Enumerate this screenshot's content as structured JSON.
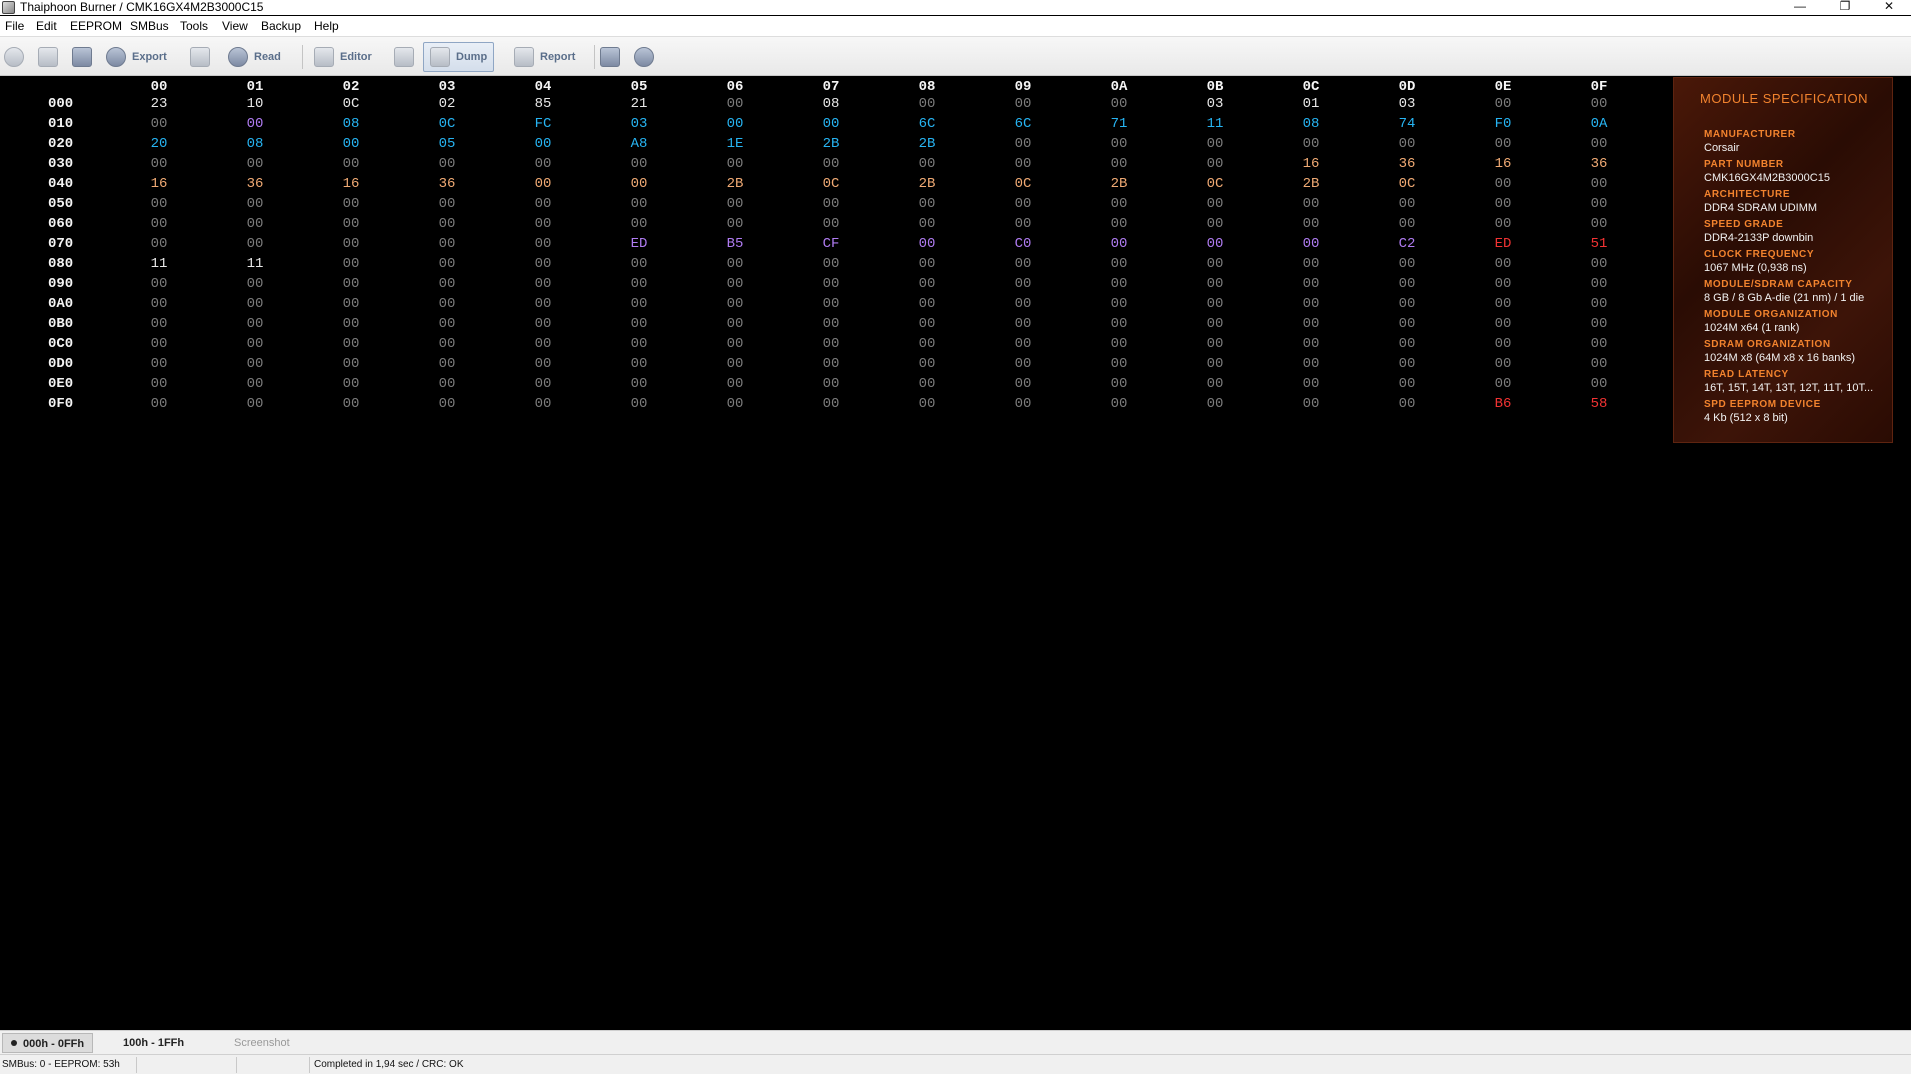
{
  "window": {
    "title": "Thaiphoon Burner / CMK16GX4M2B3000C15",
    "controls": {
      "minimize": "—",
      "maximize": "❐",
      "close": "✕"
    }
  },
  "menu": [
    "File",
    "Edit",
    "EEPROM",
    "SMBus",
    "Tools",
    "View",
    "Backup",
    "Help"
  ],
  "toolbar": {
    "export": "Export",
    "read": "Read",
    "editor": "Editor",
    "dump": "Dump",
    "report": "Report"
  },
  "dump": {
    "column_headers": [
      "00",
      "01",
      "02",
      "03",
      "04",
      "05",
      "06",
      "07",
      "08",
      "09",
      "0A",
      "0B",
      "0C",
      "0D",
      "0E",
      "0F"
    ],
    "colors": {
      "w": "#e8e8e8",
      "g": "#7c7c7c",
      "c": "#27b4f2",
      "p": "#b07cf2",
      "o": "#f0aa74",
      "r": "#f23333"
    },
    "rows": [
      {
        "addr": "000",
        "bytes": [
          "23",
          "10",
          "0C",
          "02",
          "85",
          "21",
          "00",
          "08",
          "00",
          "00",
          "00",
          "03",
          "01",
          "03",
          "00",
          "00"
        ],
        "colors": [
          "w",
          "w",
          "w",
          "w",
          "w",
          "w",
          "g",
          "w",
          "g",
          "g",
          "g",
          "w",
          "w",
          "w",
          "g",
          "g"
        ]
      },
      {
        "addr": "010",
        "bytes": [
          "00",
          "00",
          "08",
          "0C",
          "FC",
          "03",
          "00",
          "00",
          "6C",
          "6C",
          "71",
          "11",
          "08",
          "74",
          "F0",
          "0A"
        ],
        "colors": [
          "g",
          "p",
          "c",
          "c",
          "c",
          "c",
          "c",
          "c",
          "c",
          "c",
          "c",
          "c",
          "c",
          "c",
          "c",
          "c"
        ]
      },
      {
        "addr": "020",
        "bytes": [
          "20",
          "08",
          "00",
          "05",
          "00",
          "A8",
          "1E",
          "2B",
          "2B",
          "00",
          "00",
          "00",
          "00",
          "00",
          "00",
          "00"
        ],
        "colors": [
          "c",
          "c",
          "c",
          "c",
          "c",
          "c",
          "c",
          "c",
          "c",
          "g",
          "g",
          "g",
          "g",
          "g",
          "g",
          "g"
        ]
      },
      {
        "addr": "030",
        "bytes": [
          "00",
          "00",
          "00",
          "00",
          "00",
          "00",
          "00",
          "00",
          "00",
          "00",
          "00",
          "00",
          "16",
          "36",
          "16",
          "36"
        ],
        "colors": [
          "g",
          "g",
          "g",
          "g",
          "g",
          "g",
          "g",
          "g",
          "g",
          "g",
          "g",
          "g",
          "o",
          "o",
          "o",
          "o"
        ]
      },
      {
        "addr": "040",
        "bytes": [
          "16",
          "36",
          "16",
          "36",
          "00",
          "00",
          "2B",
          "0C",
          "2B",
          "0C",
          "2B",
          "0C",
          "2B",
          "0C",
          "00",
          "00"
        ],
        "colors": [
          "o",
          "o",
          "o",
          "o",
          "o",
          "o",
          "o",
          "o",
          "o",
          "o",
          "o",
          "o",
          "o",
          "o",
          "g",
          "g"
        ]
      },
      {
        "addr": "050",
        "bytes": [
          "00",
          "00",
          "00",
          "00",
          "00",
          "00",
          "00",
          "00",
          "00",
          "00",
          "00",
          "00",
          "00",
          "00",
          "00",
          "00"
        ],
        "colors": [
          "g",
          "g",
          "g",
          "g",
          "g",
          "g",
          "g",
          "g",
          "g",
          "g",
          "g",
          "g",
          "g",
          "g",
          "g",
          "g"
        ]
      },
      {
        "addr": "060",
        "bytes": [
          "00",
          "00",
          "00",
          "00",
          "00",
          "00",
          "00",
          "00",
          "00",
          "00",
          "00",
          "00",
          "00",
          "00",
          "00",
          "00"
        ],
        "colors": [
          "g",
          "g",
          "g",
          "g",
          "g",
          "g",
          "g",
          "g",
          "g",
          "g",
          "g",
          "g",
          "g",
          "g",
          "g",
          "g"
        ]
      },
      {
        "addr": "070",
        "bytes": [
          "00",
          "00",
          "00",
          "00",
          "00",
          "ED",
          "B5",
          "CF",
          "00",
          "C0",
          "00",
          "00",
          "00",
          "C2",
          "ED",
          "51"
        ],
        "colors": [
          "g",
          "g",
          "g",
          "g",
          "g",
          "p",
          "p",
          "p",
          "p",
          "p",
          "p",
          "p",
          "p",
          "p",
          "r",
          "r"
        ]
      },
      {
        "addr": "080",
        "bytes": [
          "11",
          "11",
          "00",
          "00",
          "00",
          "00",
          "00",
          "00",
          "00",
          "00",
          "00",
          "00",
          "00",
          "00",
          "00",
          "00"
        ],
        "colors": [
          "w",
          "w",
          "g",
          "g",
          "g",
          "g",
          "g",
          "g",
          "g",
          "g",
          "g",
          "g",
          "g",
          "g",
          "g",
          "g"
        ]
      },
      {
        "addr": "090",
        "bytes": [
          "00",
          "00",
          "00",
          "00",
          "00",
          "00",
          "00",
          "00",
          "00",
          "00",
          "00",
          "00",
          "00",
          "00",
          "00",
          "00"
        ],
        "colors": [
          "g",
          "g",
          "g",
          "g",
          "g",
          "g",
          "g",
          "g",
          "g",
          "g",
          "g",
          "g",
          "g",
          "g",
          "g",
          "g"
        ]
      },
      {
        "addr": "0A0",
        "bytes": [
          "00",
          "00",
          "00",
          "00",
          "00",
          "00",
          "00",
          "00",
          "00",
          "00",
          "00",
          "00",
          "00",
          "00",
          "00",
          "00"
        ],
        "colors": [
          "g",
          "g",
          "g",
          "g",
          "g",
          "g",
          "g",
          "g",
          "g",
          "g",
          "g",
          "g",
          "g",
          "g",
          "g",
          "g"
        ]
      },
      {
        "addr": "0B0",
        "bytes": [
          "00",
          "00",
          "00",
          "00",
          "00",
          "00",
          "00",
          "00",
          "00",
          "00",
          "00",
          "00",
          "00",
          "00",
          "00",
          "00"
        ],
        "colors": [
          "g",
          "g",
          "g",
          "g",
          "g",
          "g",
          "g",
          "g",
          "g",
          "g",
          "g",
          "g",
          "g",
          "g",
          "g",
          "g"
        ]
      },
      {
        "addr": "0C0",
        "bytes": [
          "00",
          "00",
          "00",
          "00",
          "00",
          "00",
          "00",
          "00",
          "00",
          "00",
          "00",
          "00",
          "00",
          "00",
          "00",
          "00"
        ],
        "colors": [
          "g",
          "g",
          "g",
          "g",
          "g",
          "g",
          "g",
          "g",
          "g",
          "g",
          "g",
          "g",
          "g",
          "g",
          "g",
          "g"
        ]
      },
      {
        "addr": "0D0",
        "bytes": [
          "00",
          "00",
          "00",
          "00",
          "00",
          "00",
          "00",
          "00",
          "00",
          "00",
          "00",
          "00",
          "00",
          "00",
          "00",
          "00"
        ],
        "colors": [
          "g",
          "g",
          "g",
          "g",
          "g",
          "g",
          "g",
          "g",
          "g",
          "g",
          "g",
          "g",
          "g",
          "g",
          "g",
          "g"
        ]
      },
      {
        "addr": "0E0",
        "bytes": [
          "00",
          "00",
          "00",
          "00",
          "00",
          "00",
          "00",
          "00",
          "00",
          "00",
          "00",
          "00",
          "00",
          "00",
          "00",
          "00"
        ],
        "colors": [
          "g",
          "g",
          "g",
          "g",
          "g",
          "g",
          "g",
          "g",
          "g",
          "g",
          "g",
          "g",
          "g",
          "g",
          "g",
          "g"
        ]
      },
      {
        "addr": "0F0",
        "bytes": [
          "00",
          "00",
          "00",
          "00",
          "00",
          "00",
          "00",
          "00",
          "00",
          "00",
          "00",
          "00",
          "00",
          "00",
          "B6",
          "58"
        ],
        "colors": [
          "g",
          "g",
          "g",
          "g",
          "g",
          "g",
          "g",
          "g",
          "g",
          "g",
          "g",
          "g",
          "g",
          "g",
          "r",
          "r"
        ]
      }
    ]
  },
  "module_spec": {
    "title": "MODULE SPECIFICATION",
    "fields": [
      {
        "label": "MANUFACTURER",
        "value": "Corsair"
      },
      {
        "label": "PART NUMBER",
        "value": "CMK16GX4M2B3000C15"
      },
      {
        "label": "ARCHITECTURE",
        "value": "DDR4 SDRAM UDIMM"
      },
      {
        "label": "SPEED GRADE",
        "value": "DDR4-2133P downbin"
      },
      {
        "label": "CLOCK FREQUENCY",
        "value": "1067 MHz (0,938 ns)"
      },
      {
        "label": "MODULE/SDRAM CAPACITY",
        "value": "8 GB / 8 Gb A-die (21 nm) / 1 die"
      },
      {
        "label": "MODULE ORGANIZATION",
        "value": "1024M x64 (1 rank)"
      },
      {
        "label": "SDRAM ORGANIZATION",
        "value": "1024M x8 (64M x8 x 16 banks)"
      },
      {
        "label": "READ LATENCY",
        "value": "16T, 15T, 14T, 13T, 12T, 11T, 10T..."
      },
      {
        "label": "SPD EEPROM DEVICE",
        "value": "4 Kb (512 x 8 bit)"
      }
    ]
  },
  "tabs": [
    {
      "label": "000h - 0FFh",
      "active": true
    },
    {
      "label": "100h - 1FFh",
      "active": false
    },
    {
      "label": "Screenshot",
      "active": false
    }
  ],
  "status": {
    "smbus": "SMBus: 0 - EEPROM: 53h",
    "blank1": "",
    "blank2": "",
    "message": "Completed in 1,94 sec / CRC: OK"
  }
}
